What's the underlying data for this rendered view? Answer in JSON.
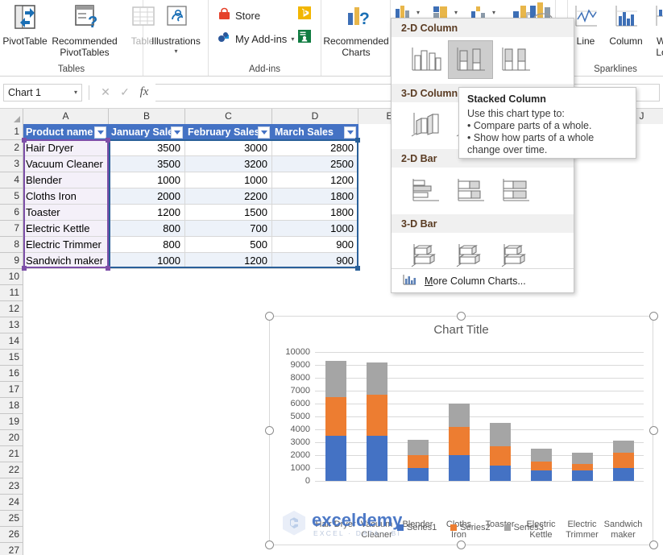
{
  "ribbon": {
    "groups": [
      {
        "label": "Tables"
      },
      {
        "label": ""
      },
      {
        "label": "Add-ins"
      },
      {
        "label": ""
      },
      {
        "label": ""
      },
      {
        "label": "Sparklines"
      }
    ],
    "pivot_table": "PivotTable",
    "recommended_pivot_tables": "Recommended\nPivotTables",
    "recommended_pivot_line1": "Recommended",
    "recommended_pivot_line2": "PivotTables",
    "table": "Table",
    "illustrations": "Illustrations",
    "store": "Store",
    "my_addins": "My Add-ins",
    "recommended_charts_line1": "Recommended",
    "recommended_charts_line2": "Charts",
    "sparkline_line": "Line",
    "sparkline_column": "Column",
    "sparkline_winloss_line1": "Win/",
    "sparkline_winloss_line2": "Loss"
  },
  "formula_bar": {
    "name_box_value": "Chart 1",
    "formula_value": "",
    "cancel_icon": "cancel-icon",
    "confirm_icon": "confirm-icon",
    "function_icon": "fx"
  },
  "grid": {
    "columns": [
      "A",
      "B",
      "C",
      "D",
      "E",
      "J"
    ],
    "rows": [
      1,
      2,
      3,
      4,
      5,
      6,
      7,
      8,
      9,
      10,
      11,
      12,
      13,
      14,
      15,
      16,
      17,
      18,
      19,
      20,
      21,
      22,
      23,
      24,
      25,
      26,
      27
    ],
    "headers": [
      "Product name",
      "January Sales",
      "February Sales",
      "March Sales"
    ],
    "data": [
      {
        "product": "Hair Dryer",
        "january": "3500",
        "february": "3000",
        "march": "2800"
      },
      {
        "product": "Vacuum Cleaner",
        "january": "3500",
        "february": "3200",
        "march": "2500"
      },
      {
        "product": "Blender",
        "january": "1000",
        "february": "1000",
        "march": "1200"
      },
      {
        "product": "Cloths Iron",
        "january": "2000",
        "february": "2200",
        "march": "1800"
      },
      {
        "product": "Toaster",
        "january": "1200",
        "february": "1500",
        "march": "1800"
      },
      {
        "product": "Electric Kettle",
        "january": "800",
        "february": "700",
        "march": "1000"
      },
      {
        "product": "Electric Trimmer",
        "january": "800",
        "february": "500",
        "march": "900"
      },
      {
        "product": "Sandwich maker",
        "january": "1000",
        "february": "1200",
        "march": "900"
      }
    ]
  },
  "gallery": {
    "sections": [
      {
        "title": "2-D Column",
        "items": [
          "Clustered Column",
          "Stacked Column",
          "100% Stacked Column"
        ],
        "selected": 1
      },
      {
        "title": "3-D Column",
        "items": [
          "3-D Clustered Column",
          "3-D Stacked Column",
          "3-D 100% Stacked Column"
        ],
        "selected": -1
      },
      {
        "title": "2-D Bar",
        "items": [
          "Clustered Bar",
          "Stacked Bar",
          "100% Stacked Bar"
        ],
        "selected": -1
      },
      {
        "title": "3-D Bar",
        "items": [
          "3-D Clustered Bar",
          "3-D Stacked Bar",
          "3-D 100% Stacked Bar"
        ],
        "selected": -1
      }
    ],
    "more_label": "More Column Charts...",
    "more_icon": "column-chart-icon"
  },
  "tooltip": {
    "title": "Stacked Column",
    "line1": "Use this chart type to:",
    "line2": "• Compare parts of a whole.",
    "line3": "• Show how parts of a whole",
    "line4": "change over time."
  },
  "colors": {
    "series1": "#4472C4",
    "series2": "#ED7D31",
    "series3": "#A5A5A5",
    "header_fill": "#4472C4",
    "selection_blue": "#2a6099",
    "selection_purple": "#7D4FA8"
  },
  "watermark": {
    "name": "exceldemy",
    "tagline": "EXCEL · DATA · BI"
  },
  "chart_data": {
    "type": "bar",
    "subtype": "stacked-column",
    "title": "Chart Title",
    "xlabel": "",
    "ylabel": "",
    "ylim": [
      0,
      10000
    ],
    "ytick_step": 1000,
    "yticks": [
      "10000",
      "9000",
      "8000",
      "7000",
      "6000",
      "5000",
      "4000",
      "3000",
      "2000",
      "1000",
      "0"
    ],
    "grid": true,
    "legend_position": "bottom",
    "categories": [
      "Hair Dryer",
      "Vacuum Cleaner",
      "Blender",
      "Cloths Iron",
      "Toaster",
      "Electric Kettle",
      "Electric Trimmer",
      "Sandwich maker"
    ],
    "category_lines": [
      [
        "Hair Dryer"
      ],
      [
        "Vacuum",
        "Cleaner"
      ],
      [
        "Blender"
      ],
      [
        "Cloths",
        "Iron"
      ],
      [
        "Toaster"
      ],
      [
        "Electric",
        "Kettle"
      ],
      [
        "Electric",
        "Trimmer"
      ],
      [
        "Sandwich",
        "maker"
      ]
    ],
    "series": [
      {
        "name": "Series1",
        "color": "#4472C4",
        "values": [
          3500,
          3500,
          1000,
          2000,
          1200,
          800,
          800,
          1000
        ]
      },
      {
        "name": "Series2",
        "color": "#ED7D31",
        "values": [
          3000,
          3200,
          1000,
          2200,
          1500,
          700,
          500,
          1200
        ]
      },
      {
        "name": "Series3",
        "color": "#A5A5A5",
        "values": [
          2800,
          2500,
          1200,
          1800,
          1800,
          1000,
          900,
          900
        ]
      }
    ],
    "totals": [
      9300,
      9200,
      3200,
      6000,
      4500,
      2500,
      2200,
      3100
    ]
  }
}
